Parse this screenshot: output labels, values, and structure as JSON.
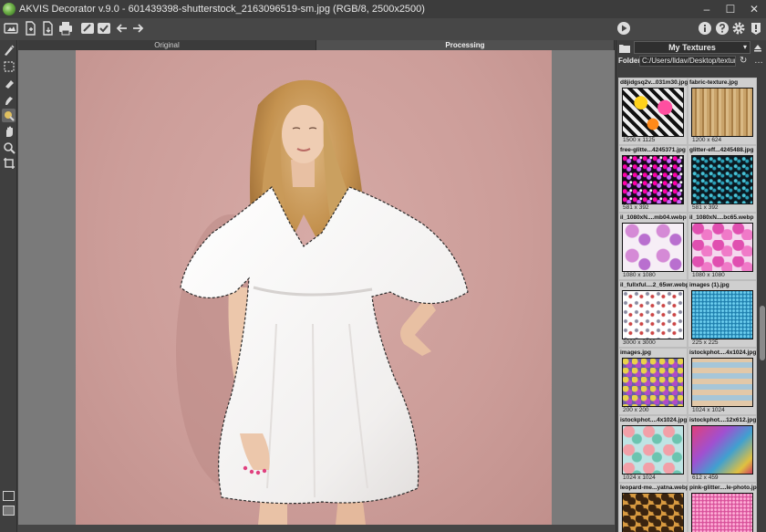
{
  "titlebar": {
    "title": "AKVIS Decorator v.9.0 - 601439398-shutterstock_2163096519-sm.jpg (RGB/8, 2500x2500)",
    "controls": [
      "–",
      "☐",
      "✕"
    ]
  },
  "tabs": {
    "original": "Original",
    "processing": "Processing"
  },
  "right_panel": {
    "library": "My Textures",
    "folder_label": "Folder",
    "folder_path": "C:/Users/lldav/Desktop/textures",
    "textures": [
      {
        "name": "d8jidgsq2v...031m30.jpg",
        "size": "1500 x 1125"
      },
      {
        "name": "fabric-texture.jpg",
        "size": "1200 x 624"
      },
      {
        "name": "free-glitte...4245371.jpg",
        "size": "581 x 392"
      },
      {
        "name": "glitter-eff...4245488.jpg",
        "size": "581 x 392"
      },
      {
        "name": "il_1080xN....mb04.webp",
        "size": "1080 x 1080"
      },
      {
        "name": "il_1080xN....bc65.webp",
        "size": "1080 x 1080"
      },
      {
        "name": "il_fullxful....2_65wr.webp",
        "size": "3000 x 3000"
      },
      {
        "name": "images (1).jpg",
        "size": "225 x 225"
      },
      {
        "name": "images.jpg",
        "size": "200 x 200"
      },
      {
        "name": "istockphot....4x1024.jpg",
        "size": "1024 x 1024"
      },
      {
        "name": "istockphot....4x1024.jpg",
        "size": "1024 x 1024"
      },
      {
        "name": "istockphot....12x612.jpg",
        "size": "612 x 459"
      },
      {
        "name": "leopard-me...yatna.webp",
        "size": ""
      },
      {
        "name": "pink-glitter....le-photo.jpg",
        "size": ""
      }
    ]
  }
}
